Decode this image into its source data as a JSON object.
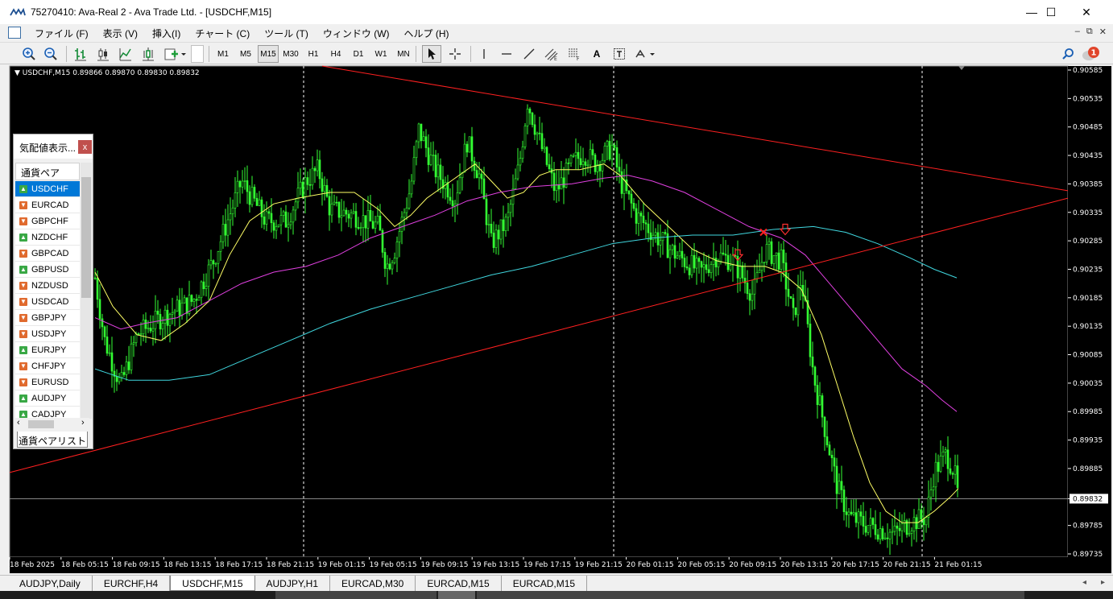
{
  "window": {
    "title": "75270410: Ava-Real 2 - Ava Trade Ltd. - [USDCHF,M15]",
    "minimize": "—",
    "maximize": "☐",
    "close": "✕"
  },
  "menu": {
    "items": [
      "ファイル (F)",
      "表示 (V)",
      "挿入(I)",
      "チャート (C)",
      "ツール (T)",
      "ウィンドウ (W)",
      "ヘルプ (H)"
    ],
    "mdi": [
      "–",
      "⧉",
      "✕"
    ]
  },
  "toolbar": {
    "timeframes": [
      "M1",
      "M5",
      "M15",
      "M30",
      "H1",
      "H4",
      "D1",
      "W1",
      "MN"
    ],
    "active_timeframe": "M15",
    "notification_count": "1",
    "text_tool": "A"
  },
  "chart": {
    "header": "USDCHF,M15  0.89866 0.89870 0.89830 0.89832",
    "current_price": "0.89832",
    "price_labels": [
      "0.90585",
      "0.90535",
      "0.90485",
      "0.90435",
      "0.90385",
      "0.90335",
      "0.90285",
      "0.90235",
      "0.90185",
      "0.90135",
      "0.90085",
      "0.90035",
      "0.89985",
      "0.89935",
      "0.89885",
      "0.89832",
      "0.89785",
      "0.89735"
    ],
    "time_labels": [
      "18 Feb 2025",
      "18 Feb 05:15",
      "18 Feb 09:15",
      "18 Feb 13:15",
      "18 Feb 17:15",
      "18 Feb 21:15",
      "19 Feb 01:15",
      "19 Feb 05:15",
      "19 Feb 09:15",
      "19 Feb 13:15",
      "19 Feb 17:15",
      "19 Feb 21:15",
      "20 Feb 01:15",
      "20 Feb 05:15",
      "20 Feb 09:15",
      "20 Feb 13:15",
      "20 Feb 17:15",
      "20 Feb 21:15",
      "21 Feb 01:15"
    ],
    "colors": {
      "background": "#000000",
      "candle": "#33ff33",
      "ma_fast": "#ffff66",
      "ma_mid": "#e040e0",
      "ma_slow": "#40d8e0",
      "trendline": "#ff2020",
      "grid": "#ffffff",
      "axis_text": "#ffffff"
    }
  },
  "market_watch": {
    "title": "気配値表示...",
    "close": "x",
    "column": "通貨ペア",
    "pairs": [
      {
        "symbol": "USDCHF",
        "dir": "up",
        "selected": true
      },
      {
        "symbol": "EURCAD",
        "dir": "down",
        "selected": false
      },
      {
        "symbol": "GBPCHF",
        "dir": "down",
        "selected": false
      },
      {
        "symbol": "NZDCHF",
        "dir": "up",
        "selected": false
      },
      {
        "symbol": "GBPCAD",
        "dir": "down",
        "selected": false
      },
      {
        "symbol": "GBPUSD",
        "dir": "up",
        "selected": false
      },
      {
        "symbol": "NZDUSD",
        "dir": "down",
        "selected": false
      },
      {
        "symbol": "USDCAD",
        "dir": "down",
        "selected": false
      },
      {
        "symbol": "GBPJPY",
        "dir": "down",
        "selected": false
      },
      {
        "symbol": "USDJPY",
        "dir": "down",
        "selected": false
      },
      {
        "symbol": "EURJPY",
        "dir": "up",
        "selected": false
      },
      {
        "symbol": "CHFJPY",
        "dir": "down",
        "selected": false
      },
      {
        "symbol": "EURUSD",
        "dir": "down",
        "selected": false
      },
      {
        "symbol": "AUDJPY",
        "dir": "up",
        "selected": false
      },
      {
        "symbol": "CADJPY",
        "dir": "up",
        "selected": false
      }
    ],
    "tab": "通貨ペアリスト"
  },
  "chart_tabs": {
    "tabs": [
      "AUDJPY,Daily",
      "EURCHF,H4",
      "USDCHF,M15",
      "AUDJPY,H1",
      "EURCAD,M30",
      "EURCAD,M15",
      "EURCAD,M15"
    ],
    "active": "USDCHF,M15"
  }
}
